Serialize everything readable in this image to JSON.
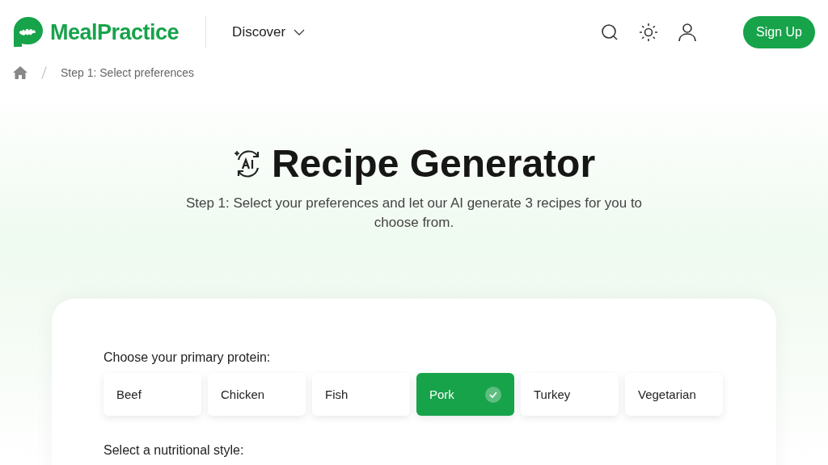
{
  "header": {
    "brand": "MealPractice",
    "nav": [
      {
        "label": "Discover"
      }
    ],
    "sign_up": "Sign Up"
  },
  "breadcrumb": {
    "current": "Step 1: Select preferences"
  },
  "hero": {
    "title": "Recipe Generator",
    "subtitle": "Step 1: Select your preferences and let our AI generate 3 recipes for you to choose from."
  },
  "form": {
    "sections": [
      {
        "label": "Choose your primary protein:",
        "options": [
          {
            "label": "Beef",
            "selected": false
          },
          {
            "label": "Chicken",
            "selected": false
          },
          {
            "label": "Fish",
            "selected": false
          },
          {
            "label": "Pork",
            "selected": true
          },
          {
            "label": "Turkey",
            "selected": false
          },
          {
            "label": "Vegetarian",
            "selected": false
          }
        ]
      },
      {
        "label": "Select a nutritional style:"
      }
    ]
  }
}
